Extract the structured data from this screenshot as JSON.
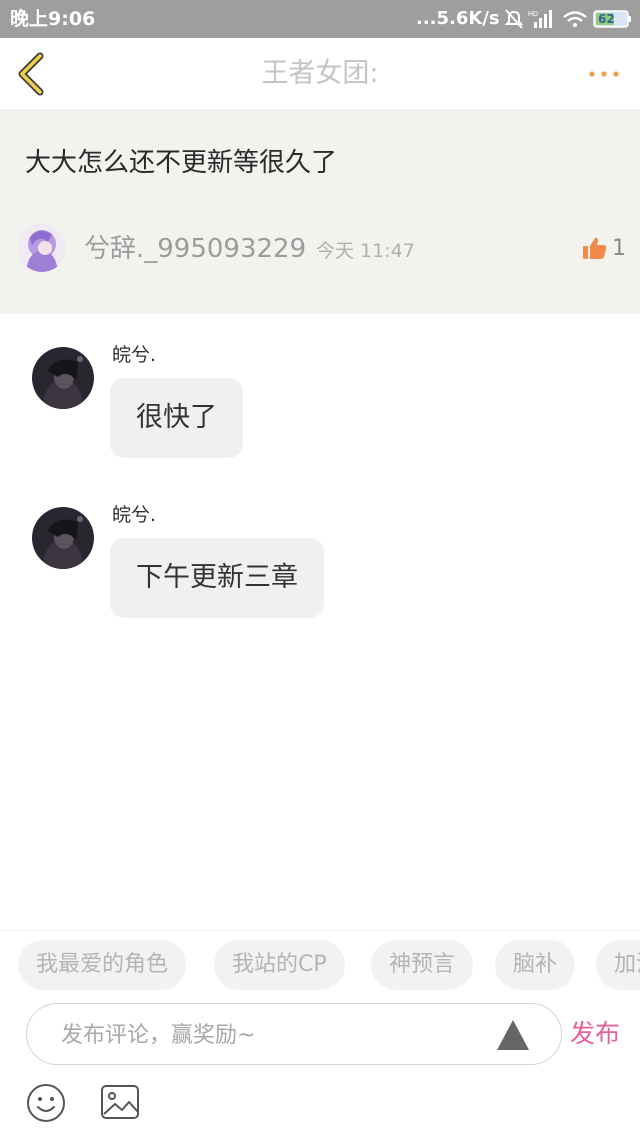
{
  "status_bar": {
    "time": "晚上9:06",
    "speed": "...5.6K/s",
    "battery": "62"
  },
  "header": {
    "title": "王者女团:",
    "accent_color": "#f0a04a"
  },
  "post": {
    "text": "大大怎么还不更新等很久了",
    "author": "兮辞._995093229",
    "time": "今天 11:47",
    "likes": "1"
  },
  "replies": [
    {
      "name": "皖兮.",
      "text": "很快了"
    },
    {
      "name": "皖兮.",
      "text": "下午更新三章"
    }
  ],
  "tags": [
    "我最爱的角色",
    "我站的CP",
    "神预言",
    "脑补",
    "加油"
  ],
  "composer": {
    "placeholder": "发布评论，赢奖励~",
    "publish_label": "发布",
    "publish_color": "#e4609a"
  }
}
